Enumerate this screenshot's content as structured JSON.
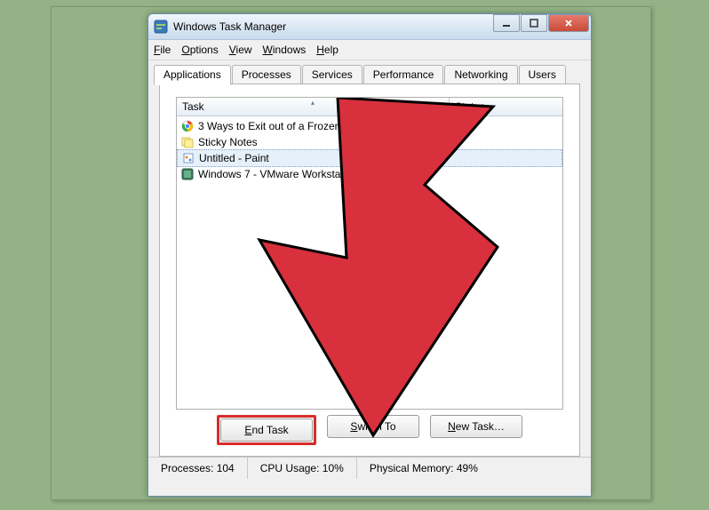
{
  "window": {
    "title": "Windows Task Manager"
  },
  "menu": {
    "file": "File",
    "options": "Options",
    "view": "View",
    "windows": "Windows",
    "help": "Help"
  },
  "tabs": {
    "applications": "Applications",
    "processes": "Processes",
    "services": "Services",
    "performance": "Performance",
    "networking": "Networking",
    "users": "Users"
  },
  "columns": {
    "task": "Task",
    "status": "Status"
  },
  "tasks": [
    {
      "name": "3 Ways to Exit out of a Frozen Computer Progra…",
      "icon": "chrome"
    },
    {
      "name": "Sticky Notes",
      "icon": "sticky"
    },
    {
      "name": "Untitled - Paint",
      "icon": "paint",
      "selected": true
    },
    {
      "name": "Windows 7 - VMware Workstat",
      "icon": "vmware"
    }
  ],
  "buttons": {
    "end_task": "End Task",
    "switch_to": "Switch To",
    "new_task": "New Task…"
  },
  "status": {
    "processes_label": "Processes:",
    "processes_value": "104",
    "cpu_label": "CPU Usage:",
    "cpu_value": "10%",
    "memory_label": "Physical Memory:",
    "memory_value": "49%"
  }
}
